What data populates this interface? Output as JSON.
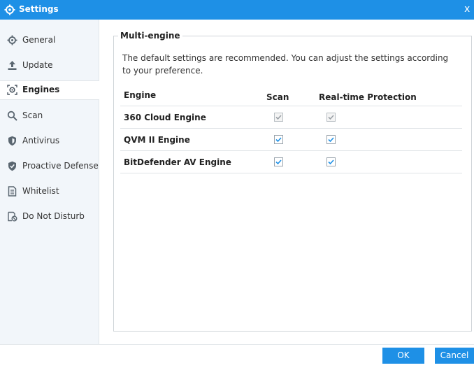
{
  "window": {
    "title": "Settings",
    "close_glyph": "x"
  },
  "sidebar": {
    "items": [
      {
        "label": "General",
        "icon": "gear-icon"
      },
      {
        "label": "Update",
        "icon": "upload-icon"
      },
      {
        "label": "Engines",
        "icon": "engine-icon",
        "active": true
      },
      {
        "label": "Scan",
        "icon": "search-icon"
      },
      {
        "label": "Antivirus",
        "icon": "shield-icon"
      },
      {
        "label": "Proactive Defense",
        "icon": "shield-check-icon"
      },
      {
        "label": "Whitelist",
        "icon": "document-icon"
      },
      {
        "label": "Do Not Disturb",
        "icon": "do-not-disturb-icon"
      }
    ]
  },
  "main": {
    "group_title": "Multi-engine",
    "description": "The default settings are recommended. You can adjust the settings according to your preference.",
    "table": {
      "headers": {
        "engine": "Engine",
        "scan": "Scan",
        "realtime": "Real-time Protection"
      },
      "rows": [
        {
          "name": "360 Cloud Engine",
          "scan": true,
          "realtime": true,
          "enabled": false
        },
        {
          "name": "QVM II Engine",
          "scan": true,
          "realtime": true,
          "enabled": true
        },
        {
          "name": "BitDefender AV Engine",
          "scan": true,
          "realtime": true,
          "enabled": true
        }
      ]
    }
  },
  "footer": {
    "ok_label": "OK",
    "cancel_label": "Cancel"
  },
  "colors": {
    "accent": "#1e90e6",
    "checkmark_enabled": "#1e90e6",
    "checkmark_disabled": "#9aa0a6"
  }
}
